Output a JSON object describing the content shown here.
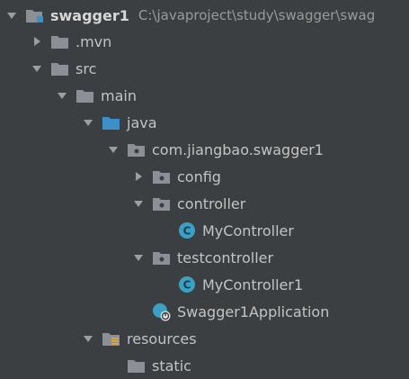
{
  "project": {
    "name": "swagger1",
    "path": "C:\\javaproject\\study\\swagger\\swag"
  },
  "tree": {
    "mvn": ".mvn",
    "src": "src",
    "main": "main",
    "java": "java",
    "package": "com.jiangbao.swagger1",
    "config": "config",
    "controller": "controller",
    "controller_class": "MyController",
    "testcontroller": "testcontroller",
    "testcontroller_class": "MyController1",
    "application": "Swagger1Application",
    "resources": "resources",
    "static": "static"
  },
  "colors": {
    "background": "#3c3f41",
    "folder": "#8c9096",
    "source_folder": "#3d8fc8",
    "class_icon": "#3aa0c4",
    "text": "#c3c3c3"
  },
  "icons": {
    "folder": "folder-icon",
    "source_folder": "source-folder-icon",
    "package": "package-icon",
    "class": "class-icon",
    "spring_boot": "spring-boot-run-icon",
    "resources": "resources-folder-icon"
  }
}
